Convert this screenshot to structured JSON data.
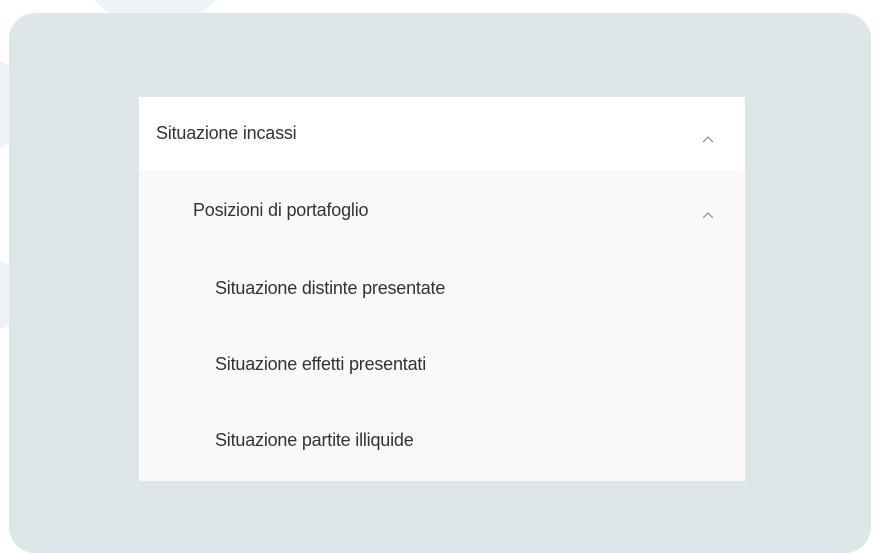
{
  "menu": {
    "section": {
      "label": "Situazione incassi",
      "icon": "chevron-up-icon",
      "expanded": true
    },
    "subsection": {
      "label": "Posizioni di portafoglio",
      "icon": "chevron-up-icon",
      "expanded": true
    },
    "items": [
      {
        "label": "Situazione distinte presentate"
      },
      {
        "label": "Situazione effetti presentati"
      },
      {
        "label": "Situazione partite illiquide"
      }
    ]
  },
  "colors": {
    "panel_background": "#dde7ea",
    "menu_background": "#f9f9f9",
    "header_background": "#ffffff",
    "text": "#333333",
    "chevron": "#999999"
  }
}
